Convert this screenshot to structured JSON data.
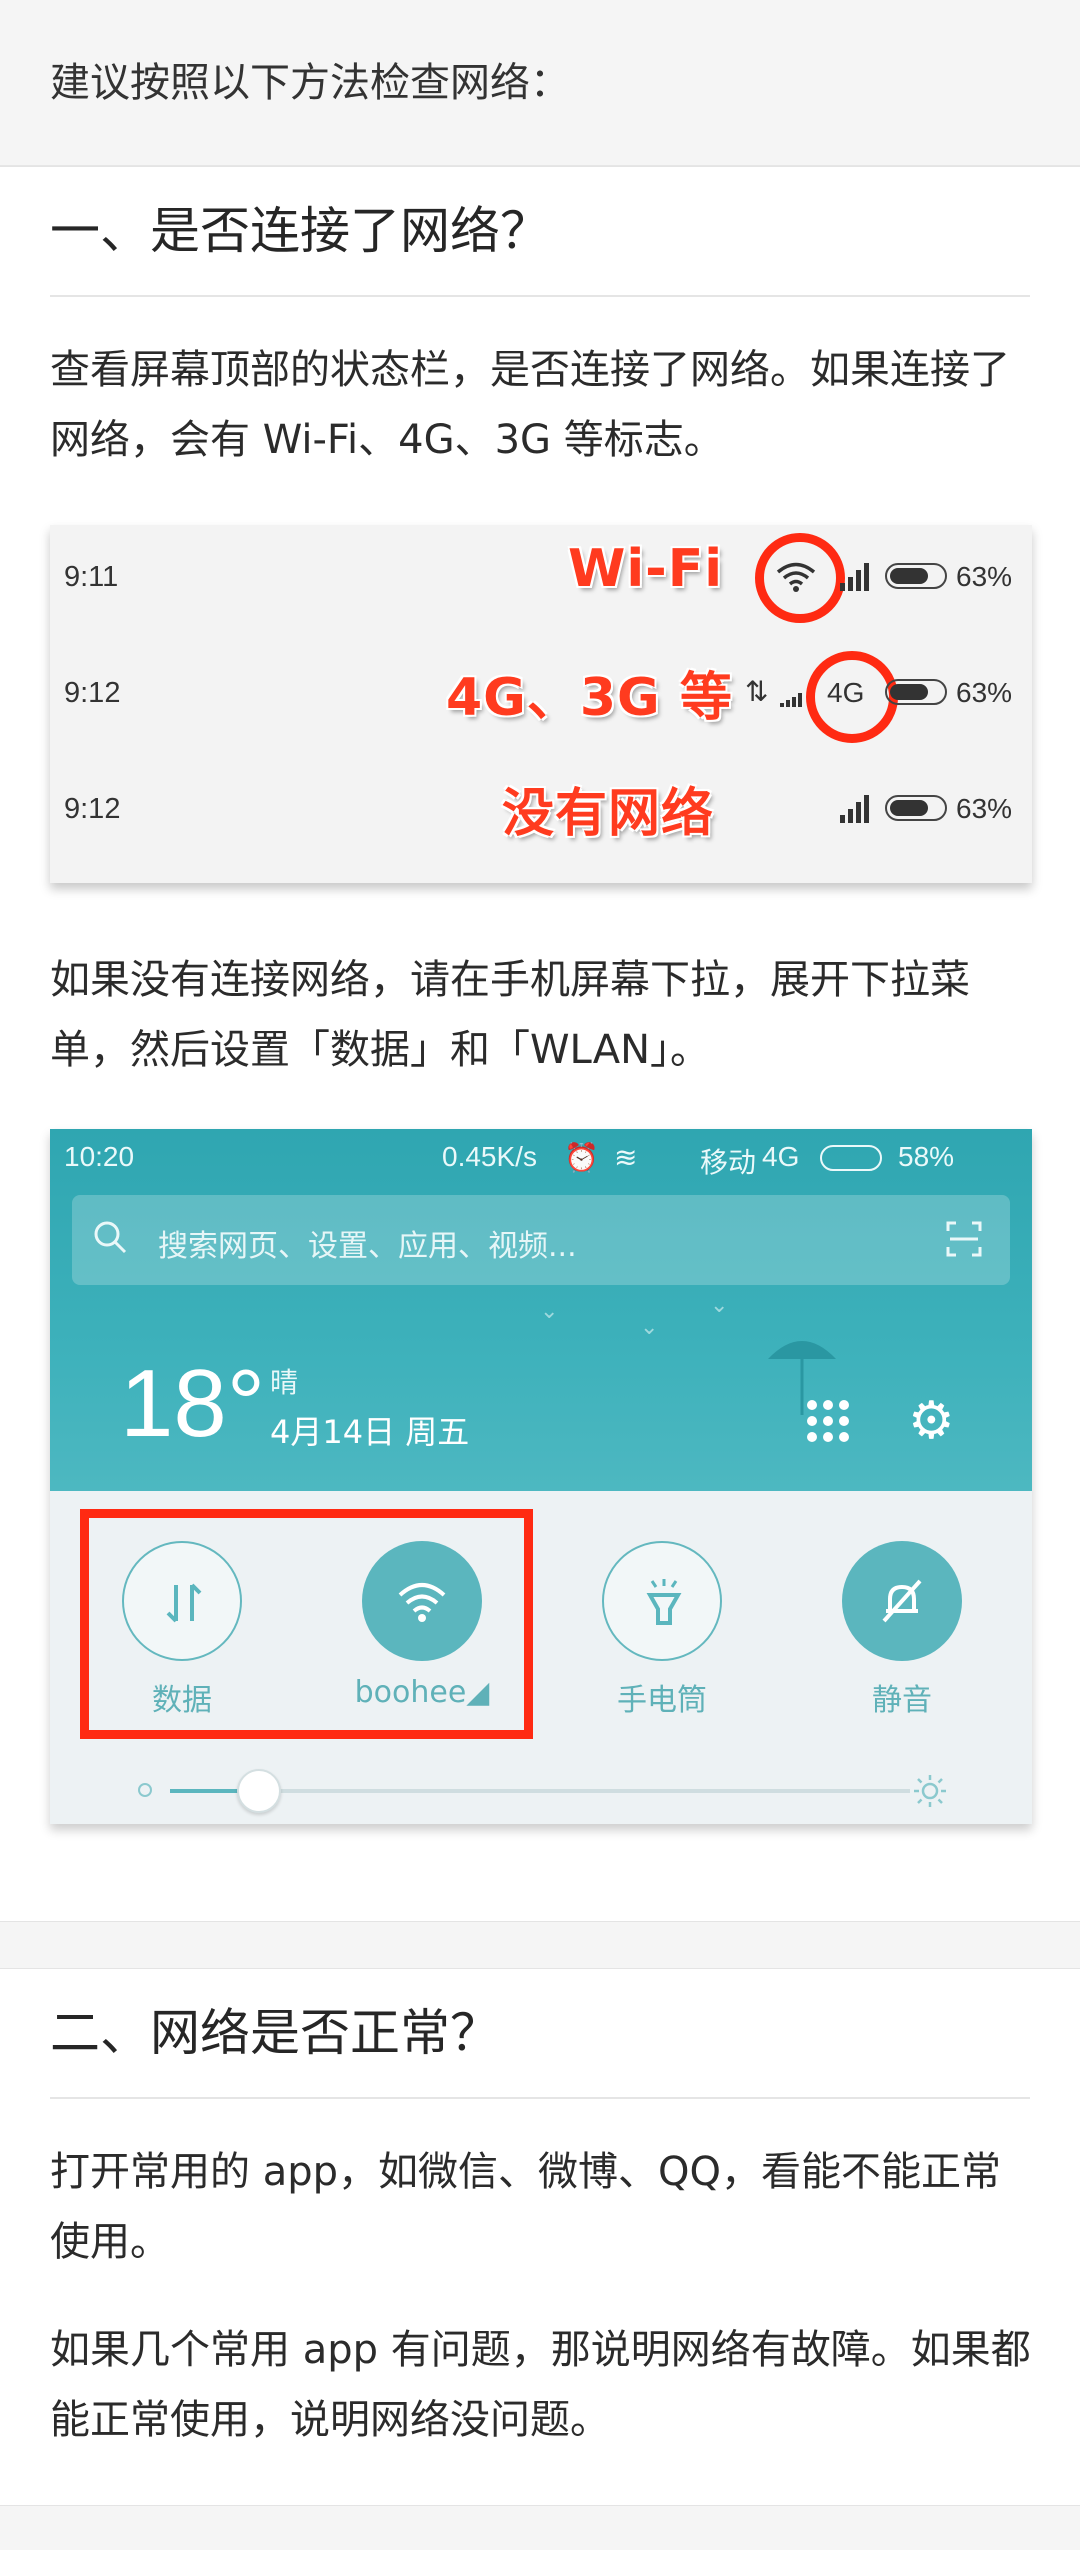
{
  "intro": {
    "text": "建议按照以下方法检查网络："
  },
  "section1": {
    "title": "一、是否连接了网络？",
    "para1": "查看屏幕顶部的状态栏，是否连接了网络。如果连接了网络，会有 Wi-Fi、4G、3G 等标志。",
    "para2": "如果没有连接网络，请在手机屏幕下拉，展开下拉菜单，然后设置「数据」和「WLAN」。",
    "status_image": {
      "rows": [
        {
          "time": "9:11",
          "label": "Wi-Fi",
          "battery": "63%"
        },
        {
          "time": "9:12",
          "label": "4G、3G 等",
          "network": "4G",
          "battery": "63%"
        },
        {
          "time": "9:12",
          "label": "没有网络",
          "battery": "63%"
        }
      ],
      "annotation_color": "#ff2a12"
    },
    "control_center": {
      "time": "10:20",
      "speed": "0.45K/s",
      "carrier": "移动",
      "network": "4G",
      "battery": "58%",
      "search_placeholder": "搜索网页、设置、应用、视频...",
      "temperature": "18°",
      "weather": "晴",
      "date": "4月14日 周五",
      "tiles": [
        {
          "label": "数据",
          "icon": "data-arrows-icon",
          "on": false
        },
        {
          "label": "boohee◢",
          "icon": "wifi-icon",
          "on": true
        },
        {
          "label": "手电筒",
          "icon": "flashlight-icon",
          "on": false
        },
        {
          "label": "静音",
          "icon": "mute-bell-icon",
          "on": true
        }
      ],
      "brightness": 0.12,
      "accent": "#5bb6be"
    }
  },
  "section2": {
    "title": "二、网络是否正常？",
    "para1": "打开常用的 app，如微信、微博、QQ，看能不能正常使用。",
    "para2": "如果几个常用 app 有问题，那说明网络有故障。如果都能正常使用，说明网络没问题。"
  }
}
